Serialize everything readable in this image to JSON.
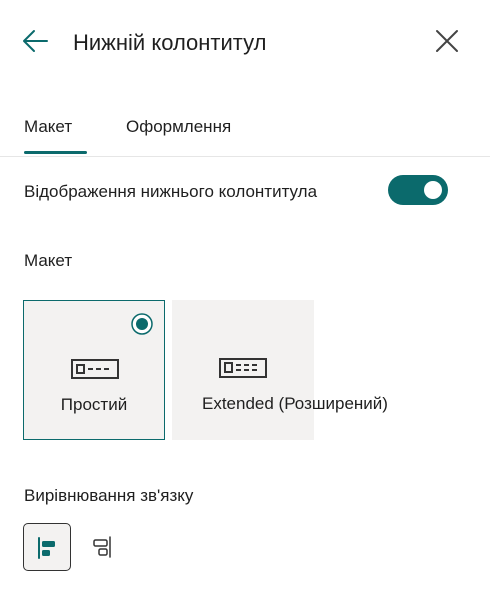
{
  "header": {
    "title": "Нижній колонтитул",
    "back_icon": "arrow-left-icon",
    "close_icon": "close-icon"
  },
  "tabs": [
    {
      "label": "Макет",
      "selected": true
    },
    {
      "label": "Оформлення",
      "selected": false
    }
  ],
  "footer_toggle": {
    "label": "Відображення нижнього колонтитула",
    "on": true
  },
  "layout_section": {
    "label": "Макет",
    "options": [
      {
        "label": "Простий",
        "selected": true,
        "icon": "simple-footer-icon"
      },
      {
        "label": "Extended (Розширений)",
        "selected": false,
        "icon": "extended-footer-icon"
      }
    ]
  },
  "alignment_section": {
    "label": "Вирівнювання зв'язку",
    "options": [
      {
        "name": "left",
        "icon": "align-left-icon",
        "selected": true
      },
      {
        "name": "right",
        "icon": "align-right-icon",
        "selected": false
      }
    ]
  },
  "colors": {
    "accent": "#0b6a6c",
    "card_background": "#f3f2f1"
  }
}
